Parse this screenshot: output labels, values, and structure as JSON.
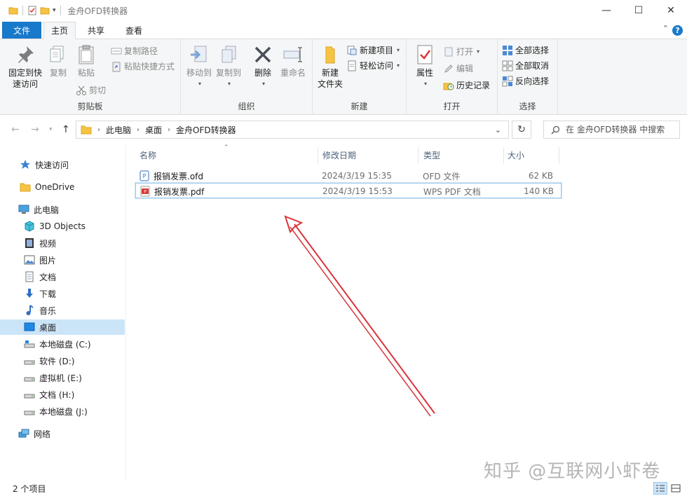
{
  "window": {
    "title": "金舟OFD转换器",
    "controls": [
      "minimize-icon",
      "maximize-icon",
      "close-icon"
    ]
  },
  "tabs": {
    "file": "文件",
    "home": "主页",
    "share": "共享",
    "view": "查看"
  },
  "ribbon": {
    "clipboard": {
      "label": "剪贴板",
      "pin_line1": "固定到快",
      "pin_line2": "速访问",
      "copy": "复制",
      "paste": "粘贴",
      "copy_path": "复制路径",
      "paste_shortcut": "粘贴快捷方式",
      "cut": "剪切"
    },
    "organize": {
      "label": "组织",
      "move_to": "移动到",
      "copy_to": "复制到",
      "delete": "删除",
      "rename": "重命名"
    },
    "new": {
      "label": "新建",
      "new_item": "新建项目",
      "easy_access": "轻松访问",
      "new_folder_line1": "新建",
      "new_folder_line2": "文件夹"
    },
    "open": {
      "label": "打开",
      "properties": "属性",
      "open": "打开",
      "edit": "编辑",
      "history": "历史记录"
    },
    "select": {
      "label": "选择",
      "select_all": "全部选择",
      "select_none": "全部取消",
      "invert": "反向选择"
    }
  },
  "address": {
    "crumbs": [
      "此电脑",
      "桌面",
      "金舟OFD转换器"
    ],
    "search_placeholder": "在 金舟OFD转换器 中搜索"
  },
  "sidebar": {
    "items": [
      {
        "label": "快速访问",
        "icon": "star-icon"
      },
      {
        "label": "OneDrive",
        "icon": "folder-icon"
      },
      {
        "label": "此电脑",
        "icon": "computer-icon"
      },
      {
        "label": "3D Objects",
        "icon": "cube-icon"
      },
      {
        "label": "视频",
        "icon": "video-icon"
      },
      {
        "label": "图片",
        "icon": "picture-icon"
      },
      {
        "label": "文档",
        "icon": "document-icon"
      },
      {
        "label": "下载",
        "icon": "download-icon"
      },
      {
        "label": "音乐",
        "icon": "music-icon"
      },
      {
        "label": "桌面",
        "icon": "desktop-icon"
      },
      {
        "label": "本地磁盘 (C:)",
        "icon": "drive-icon"
      },
      {
        "label": "软件 (D:)",
        "icon": "drive-icon"
      },
      {
        "label": "虚拟机 (E:)",
        "icon": "drive-icon"
      },
      {
        "label": "文档 (H:)",
        "icon": "drive-icon"
      },
      {
        "label": "本地磁盘 (J:)",
        "icon": "drive-icon"
      },
      {
        "label": "网络",
        "icon": "network-icon"
      }
    ]
  },
  "file_list": {
    "columns": [
      "名称",
      "修改日期",
      "类型",
      "大小"
    ],
    "rows": [
      {
        "name": "报销发票.ofd",
        "date": "2024/3/19 15:35",
        "type": "OFD 文件",
        "size": "62 KB",
        "icon": "ofd-file-icon"
      },
      {
        "name": "报销发票.pdf",
        "date": "2024/3/19 15:53",
        "type": "WPS PDF 文档",
        "size": "140 KB",
        "icon": "pdf-file-icon"
      }
    ]
  },
  "status": {
    "count": "2 个项目"
  },
  "watermark": "知乎 @互联网小虾卷",
  "colors": {
    "accent": "#1979ca",
    "selection": "#cce4f7",
    "annotation_arrow": "#d9343a"
  }
}
